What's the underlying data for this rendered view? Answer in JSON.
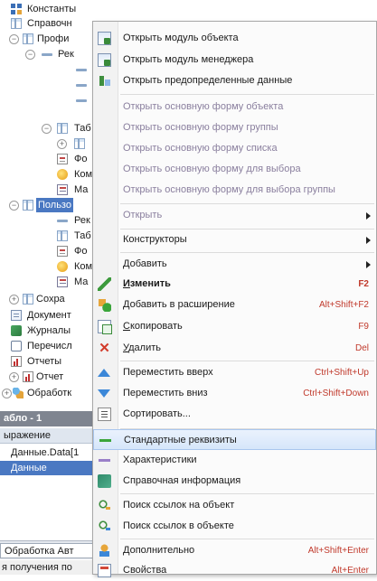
{
  "tree": {
    "constants": "Константы",
    "catalogs": "Справочн",
    "catalog_prof": "Профи",
    "req_short": "Рек",
    "tab_short": "Таб",
    "form_short": "Фо",
    "cmd_short": "Ком",
    "layout_short": "Ма",
    "catalog_user": "Пользо",
    "saved": "Сохра",
    "documents": "Документ",
    "journals": "Журналы",
    "enums": "Перечисл",
    "reports": "Отчеты",
    "report_item": "Отчет",
    "processing": "Обработк"
  },
  "bottom_panel": {
    "title": "абло - 1",
    "column": "ыражение",
    "rows": [
      "Данные.Data[1",
      "Данные"
    ],
    "tab_label": "Обработка Авт",
    "status": "я получения по"
  },
  "menu": {
    "open_object_module": "Открыть модуль объекта",
    "open_manager_module": "Открыть модуль менеджера",
    "open_predefined": "Открыть предопределенные данные",
    "open_object_form": "Открыть основную форму объекта",
    "open_group_form": "Открыть основную форму группы",
    "open_list_form": "Открыть основную форму списка",
    "open_choice_form": "Открыть основную форму для выбора",
    "open_group_choice_form": "Открыть основную форму для выбора группы",
    "open": "Открыть",
    "constructors": "Конструкторы",
    "add": "Добавить",
    "edit": "Изменить",
    "edit_sc": "F2",
    "add_to_ext": "Добавить в расширение",
    "add_to_ext_sc": "Alt+Shift+F2",
    "copy": "Скопировать",
    "copy_sc": "F9",
    "delete": "Удалить",
    "delete_sc": "Del",
    "move_up": "Переместить вверх",
    "move_up_sc": "Ctrl+Shift+Up",
    "move_down": "Переместить вниз",
    "move_down_sc": "Ctrl+Shift+Down",
    "sort": "Сортировать...",
    "std_attrs": "Стандартные реквизиты",
    "characteristics": "Характеристики",
    "reference_info": "Справочная информация",
    "find_refs_to": "Поиск ссылок на объект",
    "find_refs_in": "Поиск ссылок в объекте",
    "advanced": "Дополнительно",
    "advanced_sc": "Alt+Shift+Enter",
    "properties": "Свойства",
    "properties_sc": "Alt+Enter"
  }
}
